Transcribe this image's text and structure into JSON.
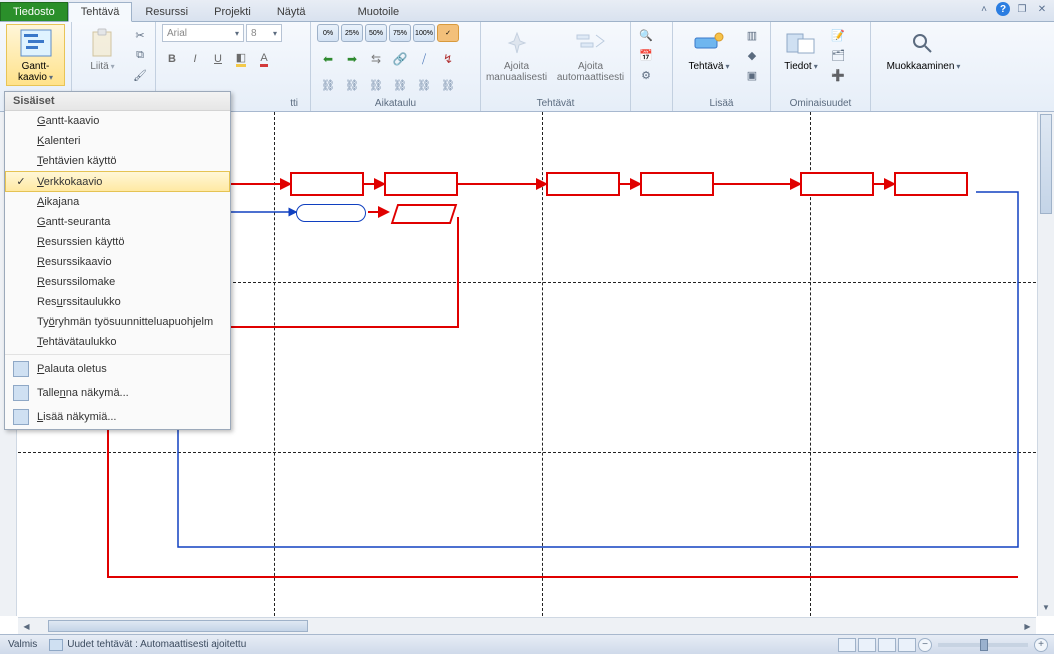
{
  "tabs": {
    "file": "Tiedosto",
    "task": "Tehtävä",
    "resource": "Resurssi",
    "project": "Projekti",
    "view": "Näytä",
    "format": "Muotoile"
  },
  "ribbon": {
    "gantt_button": "Gantt-kaavio",
    "paste_button": "Liitä",
    "font_name": "Arial",
    "font_size": "8",
    "pct_labels": [
      "0%",
      "25%",
      "50%",
      "75%",
      "100%"
    ],
    "group_font": "tti",
    "group_schedule": "Aikataulu",
    "schedule_manual": "Ajoita manuaalisesti",
    "schedule_auto": "Ajoita automaattisesti",
    "group_tasks": "Tehtävät",
    "task_button": "Tehtävä",
    "group_insert": "Lisää",
    "info_button": "Tiedot",
    "group_props": "Ominaisuudet",
    "group_editing": "Muokkaaminen"
  },
  "dropdown": {
    "header": "Sisäiset",
    "items": [
      {
        "label": "Gantt-kaavio",
        "underline_char": "G"
      },
      {
        "label": "Kalenteri",
        "underline_char": "K"
      },
      {
        "label": "Tehtävien käyttö",
        "underline_char": "T"
      },
      {
        "label": "Verkkokaavio",
        "underline_char": "V",
        "selected": true
      },
      {
        "label": "Aikajana",
        "underline_char": "A"
      },
      {
        "label": "Gantt-seuranta",
        "underline_char": "G"
      },
      {
        "label": "Resurssien käyttö",
        "underline_char": "R"
      },
      {
        "label": "Resurssikaavio",
        "underline_char": "R"
      },
      {
        "label": "Resurssilomake",
        "underline_char": "R"
      },
      {
        "label": "Resurssitaulukko",
        "underline_char": "u"
      },
      {
        "label": "Työryhmän työsuunnitteluapuohjelm",
        "underline_char": "ö"
      },
      {
        "label": "Tehtävätaulukko",
        "underline_char": "T"
      }
    ],
    "footer": [
      {
        "label": "Palauta oletus",
        "underline_char": "P",
        "icon": true
      },
      {
        "label": "Tallenna näkymä...",
        "underline_char": "n",
        "icon": true
      },
      {
        "label": "Lisää näkymiä...",
        "underline_char": "L",
        "icon": true
      }
    ]
  },
  "status": {
    "ready": "Valmis",
    "new_tasks": "Uudet tehtävät : Automaattisesti ajoitettu"
  }
}
